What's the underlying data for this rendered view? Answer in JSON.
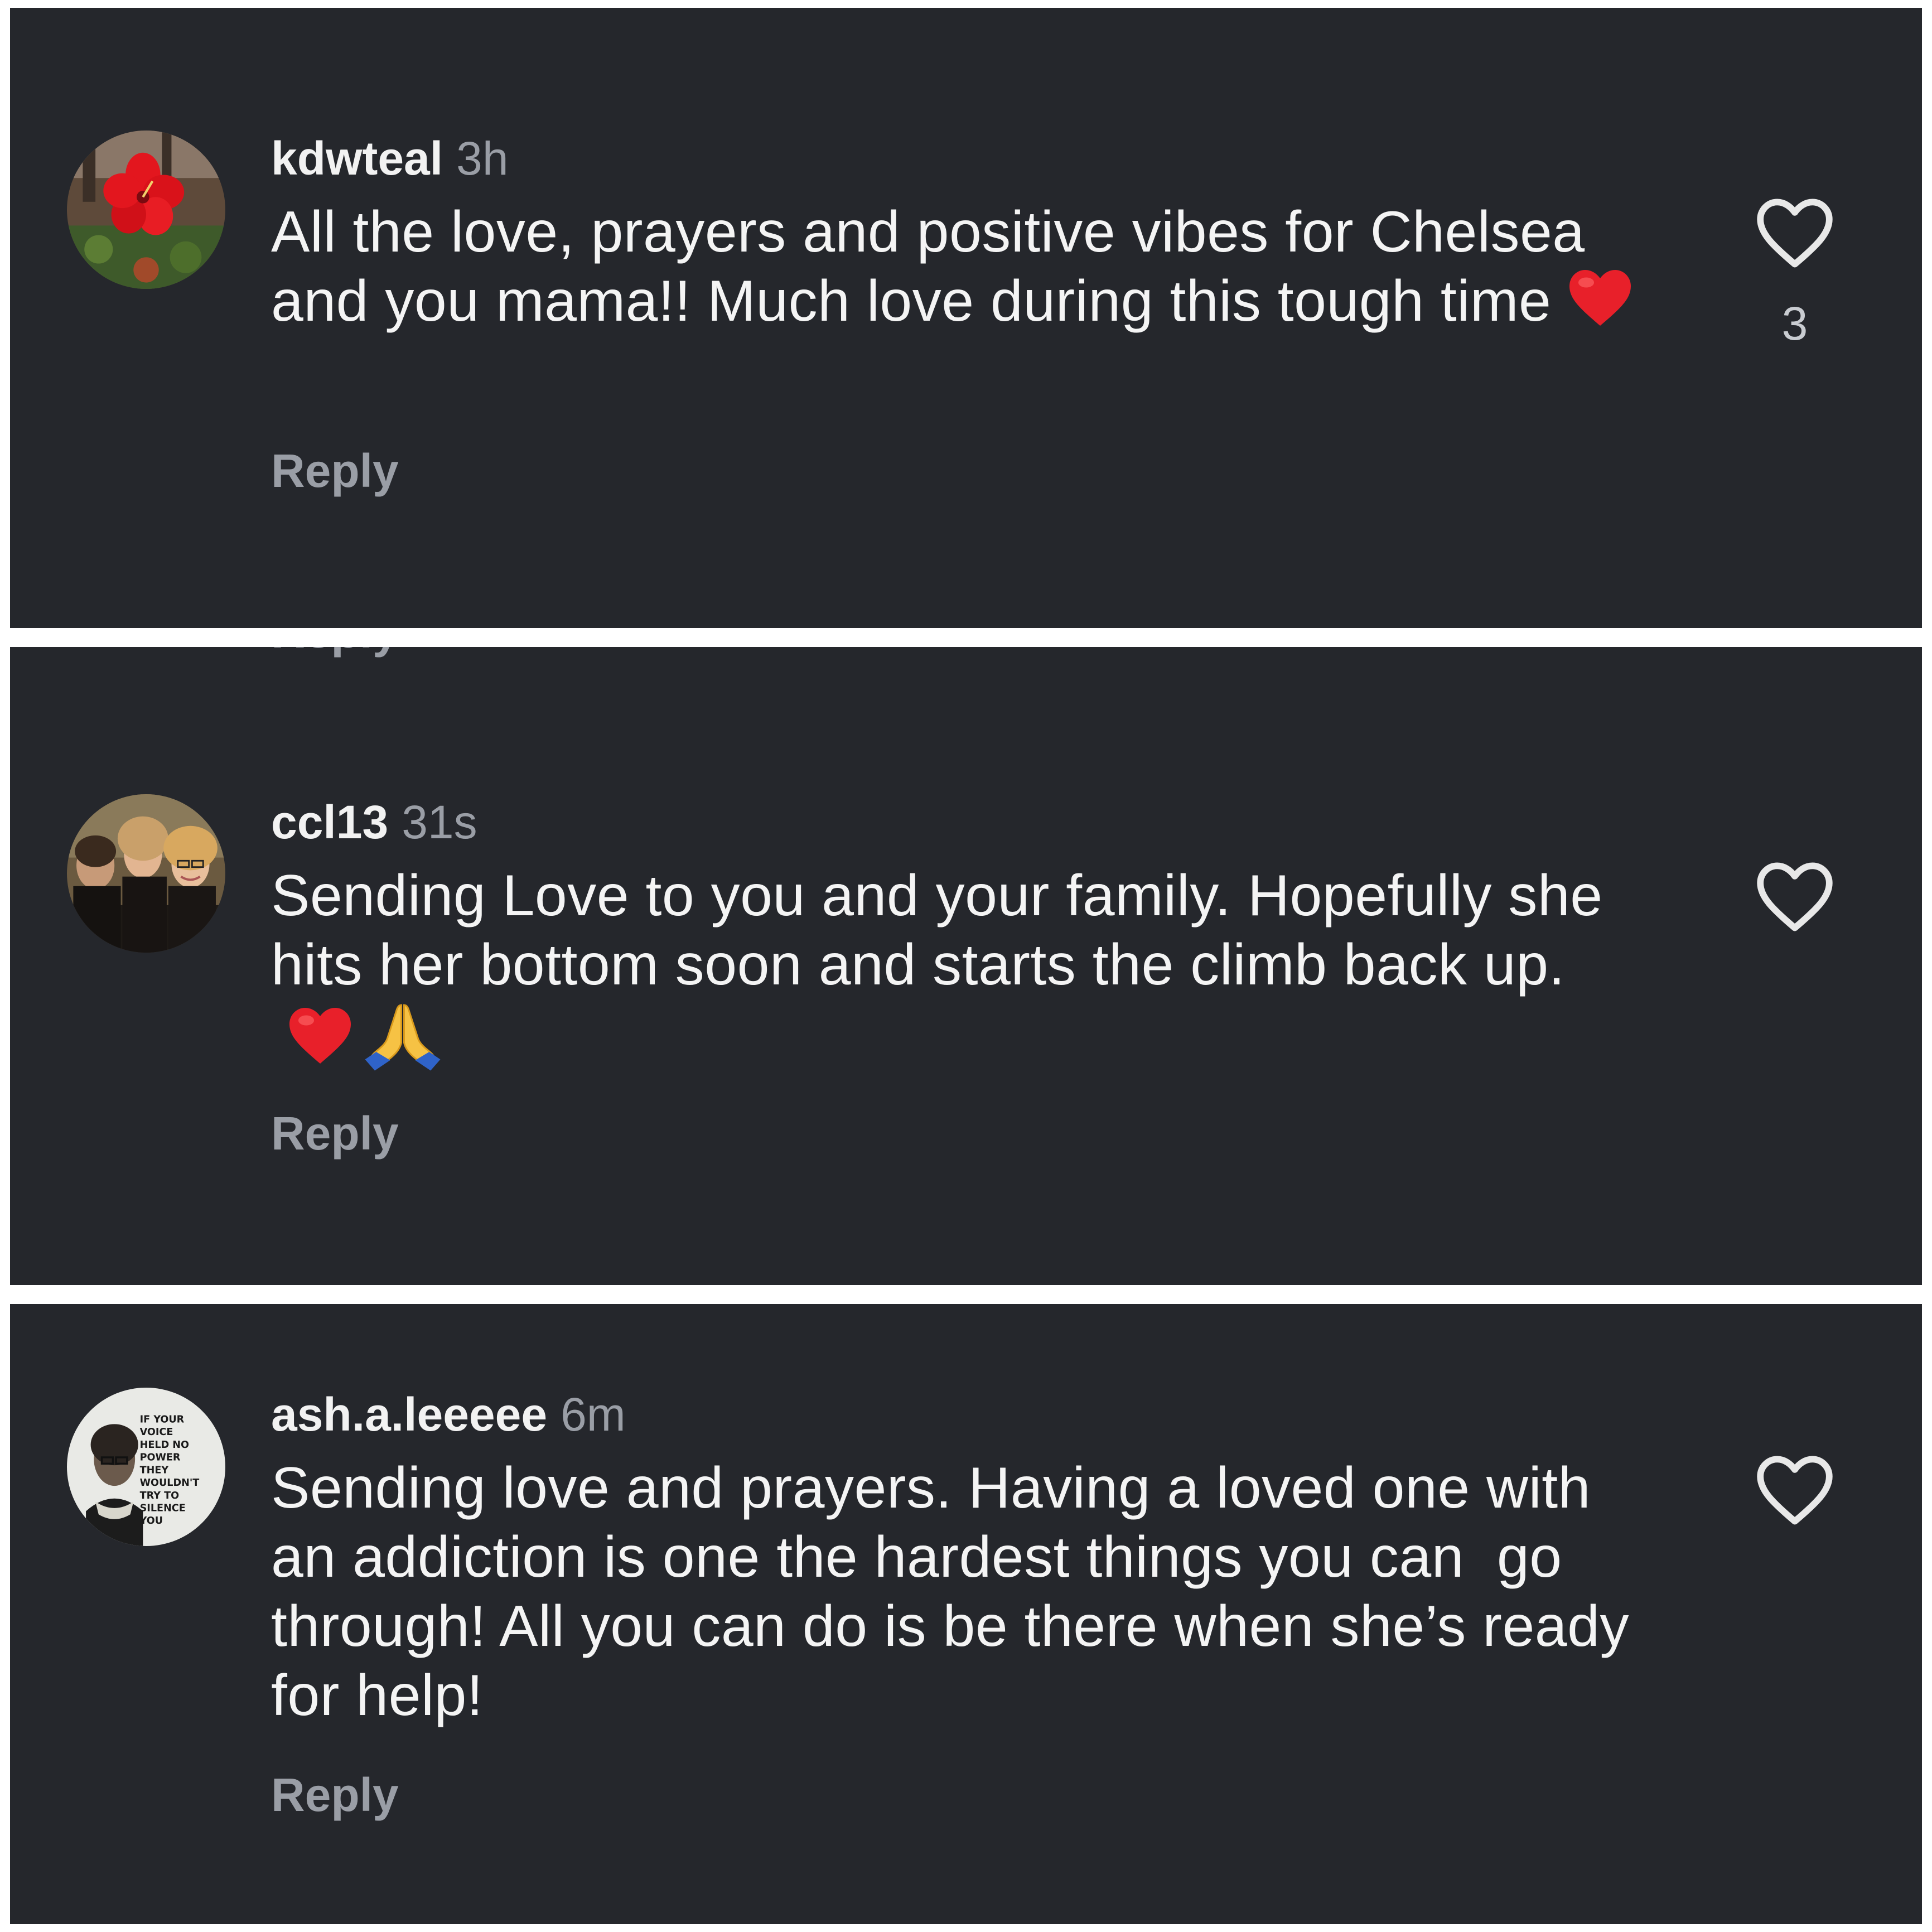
{
  "comments": [
    {
      "username": "kdwteal",
      "time": "3h",
      "text": "All the love, prayers and positive vibes for Chelsea and you mama!! Much love during this tough time",
      "emoji": [
        "heart"
      ],
      "reply_label": "Reply",
      "like_count": "3",
      "avatar": "red-hibiscus-flower-photo"
    },
    {
      "username": "ccl13",
      "time": "31s",
      "text": "Sending Love to you and your family. Hopefully she hits her bottom soon and starts the climb back up.",
      "emoji": [
        "heart",
        "praying-hands"
      ],
      "reply_label": "Reply",
      "like_count": "",
      "avatar": "group-selfie-photo"
    },
    {
      "username": "ash.a.leeeee",
      "time": "6m",
      "text": "Sending love and prayers. Having a loved one with an addiction is one the hardest things you can  go through! All you can do is be there when she’s ready for help!",
      "emoji": [],
      "reply_label": "Reply",
      "like_count": "",
      "avatar": "quote-portrait-image",
      "avatar_text": "IF YOUR VOICE HELD NO POWER THEY WOULDN'T TRY TO SILENCE YOU"
    }
  ],
  "colors": {
    "panel_bg": "#25272c",
    "text_primary": "#f4f4f4",
    "text_secondary": "#9a9ea6",
    "heart_emoji": "#e8202a"
  }
}
